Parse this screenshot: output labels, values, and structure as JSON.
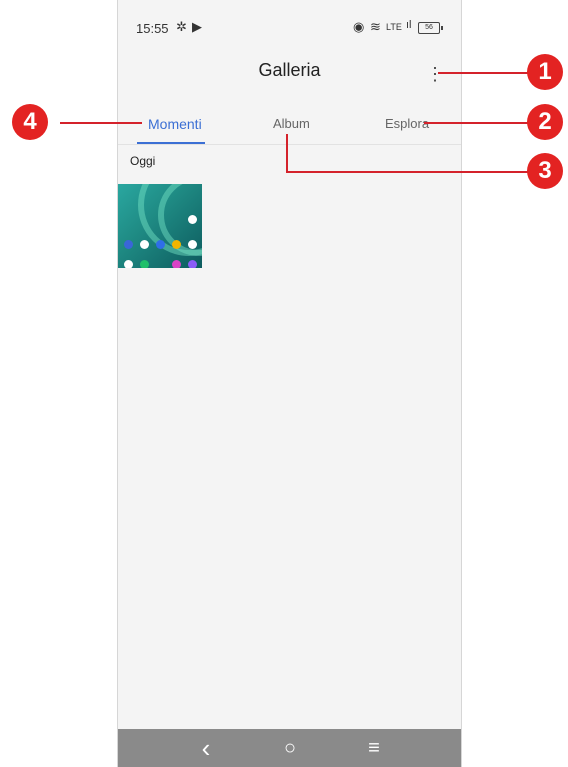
{
  "status_bar": {
    "time": "15:55",
    "battery": "56"
  },
  "app": {
    "title": "Galleria"
  },
  "tabs": [
    {
      "label": "Momenti",
      "active": true
    },
    {
      "label": "Album",
      "active": false
    },
    {
      "label": "Esplora",
      "active": false
    }
  ],
  "section": {
    "label": "Oggi"
  },
  "navigation": {
    "back": "‹",
    "home": "○",
    "recents": "≡"
  },
  "callouts": [
    "1",
    "2",
    "3",
    "4"
  ],
  "colors": {
    "accent": "#3b6fd4",
    "callout": "#e32322",
    "navbar": "#8a8a8a"
  }
}
